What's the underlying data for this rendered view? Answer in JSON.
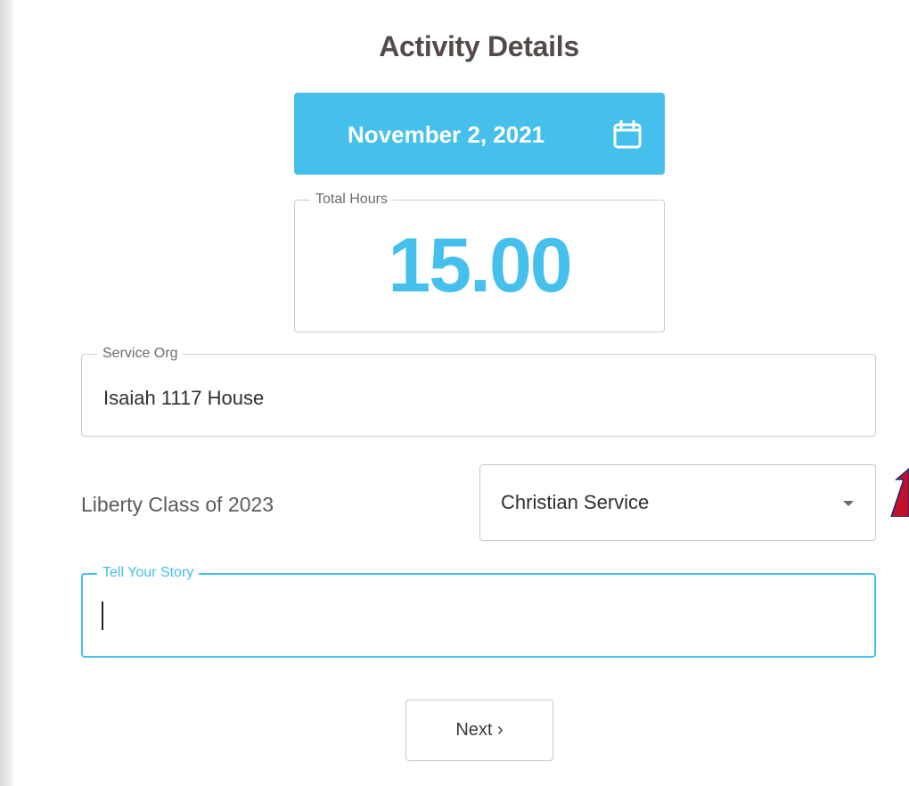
{
  "header": {
    "title": "Activity Details"
  },
  "date_picker": {
    "label": "November 2, 2021",
    "icon": "calendar-icon"
  },
  "hours": {
    "legend": "Total Hours",
    "value": "15.00"
  },
  "service_org": {
    "legend": "Service Org",
    "value": "Isaiah 1117 House"
  },
  "class_label": "Liberty Class of 2023",
  "service_type": {
    "selected": "Christian Service",
    "icon": "chevron-down-icon"
  },
  "story": {
    "legend": "Tell Your Story",
    "value": ""
  },
  "next_button": {
    "label": "Next ›"
  },
  "annotation": {
    "icon": "red-arrow-icon"
  },
  "colors": {
    "accent": "#45bfec",
    "title": "#554a4a",
    "annotation_arrow": "#c0102a",
    "border": "#c9c9c9"
  }
}
